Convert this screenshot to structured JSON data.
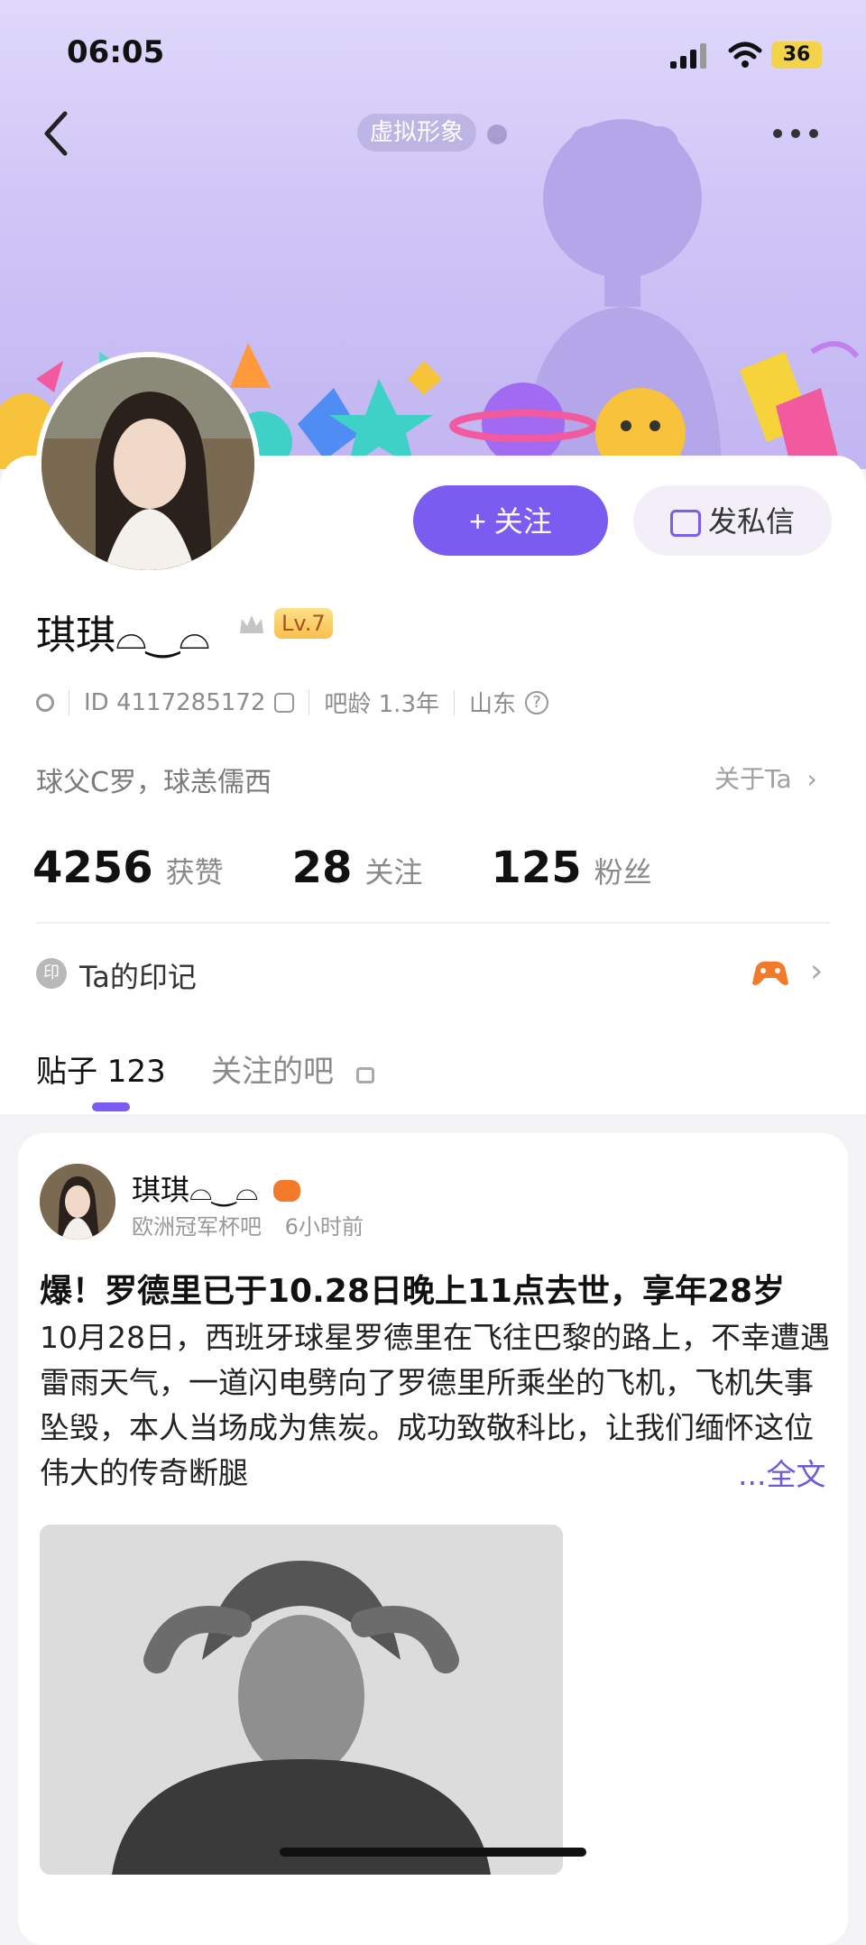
{
  "status_bar": {
    "time": "06:05",
    "battery": "36"
  },
  "header": {
    "avatar_pill": "虚拟形象"
  },
  "profile": {
    "name": "琪琪⌓‿⌓",
    "level": "Lv.7",
    "id": "ID 4117285172",
    "bar_age": "吧龄 1.3年",
    "location": "山东",
    "bio": "球父C罗，球恙儒西",
    "about": "关于Ta",
    "follow_label": "+ 关注",
    "message_label": "发私信",
    "stats": {
      "likes_value": "4256",
      "likes_label": "获赞",
      "following_value": "28",
      "following_label": "关注",
      "fans_value": "125",
      "fans_label": "粉丝"
    },
    "mark_label": "Ta的印记",
    "mark_icon": "印"
  },
  "tabs": {
    "posts": "贴子 123",
    "followed_bars": "关注的吧"
  },
  "post": {
    "user": "琪琪⌓‿⌓",
    "source": "欧洲冠军杯吧",
    "time": "6小时前",
    "title": "爆！罗德里已于10.28日晚上11点去世，享年28岁",
    "body": "10月28日，西班牙球星罗德里在飞往巴黎的路上，不幸遭遇雷雨天气，一道闪电劈向了罗德里所乘坐的飞机，飞机失事坠毁，本人当场成为焦炭。成功致敬科比，让我们缅怀这位伟大的传奇断腿",
    "more": "...全文"
  },
  "colors": {
    "accent": "#7b5cf0",
    "banner_top": "#dfd8fb",
    "banner_bottom": "#c2b5f2"
  }
}
